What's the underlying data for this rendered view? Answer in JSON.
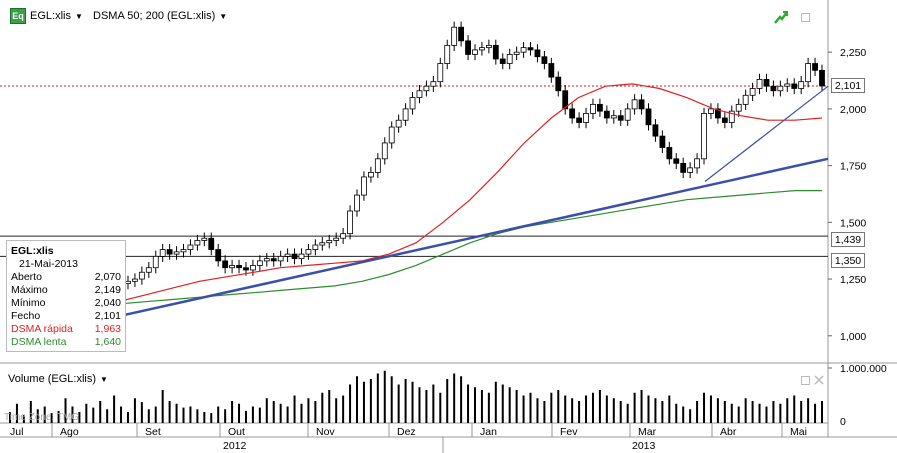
{
  "header": {
    "icon": "Eq",
    "symbol": "EGL:xlis",
    "indicator": "DSMA 50; 200 (EGL:xlis)"
  },
  "info_box": {
    "title": "EGL:xlis",
    "date": "21-Mai-2013",
    "rows": [
      {
        "label": "Aberto",
        "value": "2,070",
        "color": "#000000"
      },
      {
        "label": "Máximo",
        "value": "2,149",
        "color": "#000000"
      },
      {
        "label": "Mínimo",
        "value": "2,040",
        "color": "#000000"
      },
      {
        "label": "Fecho",
        "value": "2,101",
        "color": "#000000"
      },
      {
        "label": "DSMA rápida",
        "value": "1,963",
        "color": "#e02020"
      },
      {
        "label": "DSMA lenta",
        "value": "1,640",
        "color": "#2e8b2e"
      }
    ]
  },
  "volume_panel": {
    "title": "Volume (EGL:xlis)",
    "ticks": [
      "1.000.000",
      "0"
    ]
  },
  "timezone_label": "Time Zone: TMG",
  "chart_data": {
    "type": "candlestick",
    "y_ticks": [
      "2,250",
      "2,000",
      "1,750",
      "1,500",
      "1,250",
      "1,000"
    ],
    "ylim": [
      0.88,
      2.48
    ],
    "x_months": [
      "Jul",
      "Ago",
      "Set",
      "Out",
      "Nov",
      "Dez",
      "Jan",
      "Fev",
      "Mar",
      "Abr",
      "Mai"
    ],
    "x_years": [
      "2012",
      "2013"
    ],
    "last_price": {
      "value": 2.101,
      "label": "2,101"
    },
    "horizontal_levels": [
      {
        "value": 1.439,
        "label": "1,439"
      },
      {
        "value": 1.35,
        "label": "1,350"
      }
    ],
    "close_series": [
      1.05,
      1.07,
      1.06,
      1.09,
      1.1,
      1.11,
      1.14,
      1.18,
      1.2,
      1.19,
      1.2,
      1.22,
      1.21,
      1.23,
      1.22,
      1.21,
      1.23,
      1.24,
      1.25,
      1.28,
      1.3,
      1.35,
      1.38,
      1.36,
      1.37,
      1.38,
      1.4,
      1.42,
      1.43,
      1.38,
      1.33,
      1.3,
      1.31,
      1.3,
      1.29,
      1.31,
      1.33,
      1.34,
      1.33,
      1.35,
      1.36,
      1.34,
      1.36,
      1.38,
      1.4,
      1.41,
      1.42,
      1.43,
      1.45,
      1.55,
      1.62,
      1.7,
      1.72,
      1.78,
      1.85,
      1.92,
      1.95,
      2.0,
      2.05,
      2.08,
      2.1,
      2.12,
      2.2,
      2.28,
      2.36,
      2.3,
      2.24,
      2.26,
      2.27,
      2.28,
      2.22,
      2.2,
      2.24,
      2.25,
      2.27,
      2.26,
      2.23,
      2.2,
      2.14,
      2.08,
      2.0,
      1.96,
      1.94,
      1.98,
      2.02,
      1.99,
      1.96,
      1.97,
      1.95,
      2.0,
      2.04,
      2.0,
      1.93,
      1.88,
      1.83,
      1.78,
      1.76,
      1.72,
      1.74,
      1.78,
      1.98,
      2.0,
      1.96,
      1.94,
      1.99,
      2.02,
      2.06,
      2.09,
      2.13,
      2.1,
      2.08,
      2.1,
      2.11,
      2.09,
      2.12,
      2.2,
      2.17,
      2.101
    ],
    "series": [
      {
        "name": "DSMA rápida",
        "color": "#e02020",
        "values": [
          1.05,
          1.07,
          1.09,
          1.12,
          1.15,
          1.18,
          1.21,
          1.24,
          1.26,
          1.28,
          1.3,
          1.31,
          1.32,
          1.33,
          1.36,
          1.41,
          1.5,
          1.6,
          1.72,
          1.85,
          1.96,
          2.05,
          2.1,
          2.11,
          2.09,
          2.05,
          2.0,
          1.97,
          1.95,
          1.95,
          1.96
        ]
      },
      {
        "name": "DSMA lenta",
        "color": "#2e8b2e",
        "values": [
          1.1,
          1.11,
          1.12,
          1.13,
          1.14,
          1.15,
          1.16,
          1.17,
          1.18,
          1.19,
          1.2,
          1.21,
          1.22,
          1.24,
          1.27,
          1.31,
          1.36,
          1.41,
          1.45,
          1.48,
          1.5,
          1.52,
          1.54,
          1.56,
          1.58,
          1.6,
          1.61,
          1.62,
          1.63,
          1.64,
          1.64
        ]
      }
    ],
    "trendlines": [
      {
        "color": "#3a4fa8",
        "from": 0.98,
        "to": 1.78
      },
      {
        "color": "#3a4fa8",
        "from": 1.68,
        "to": 2.1
      }
    ],
    "volume": [
      20,
      35,
      15,
      40,
      25,
      30,
      18,
      22,
      45,
      30,
      20,
      35,
      28,
      40,
      25,
      50,
      30,
      20,
      45,
      38,
      25,
      30,
      60,
      40,
      35,
      28,
      30,
      25,
      20,
      18,
      30,
      25,
      40,
      35,
      22,
      30,
      28,
      45,
      40,
      35,
      30,
      50,
      35,
      45,
      40,
      55,
      60,
      45,
      50,
      70,
      85,
      75,
      80,
      90,
      95,
      85,
      70,
      80,
      75,
      65,
      60,
      70,
      55,
      80,
      90,
      85,
      70,
      65,
      60,
      55,
      75,
      70,
      65,
      60,
      50,
      55,
      45,
      40,
      55,
      60,
      50,
      45,
      40,
      50,
      55,
      60,
      50,
      45,
      40,
      35,
      55,
      60,
      50,
      45,
      40,
      50,
      35,
      30,
      25,
      40,
      55,
      50,
      45,
      40,
      35,
      30,
      45,
      40,
      35,
      30,
      40,
      35,
      45,
      50,
      40,
      45,
      35,
      40
    ]
  }
}
